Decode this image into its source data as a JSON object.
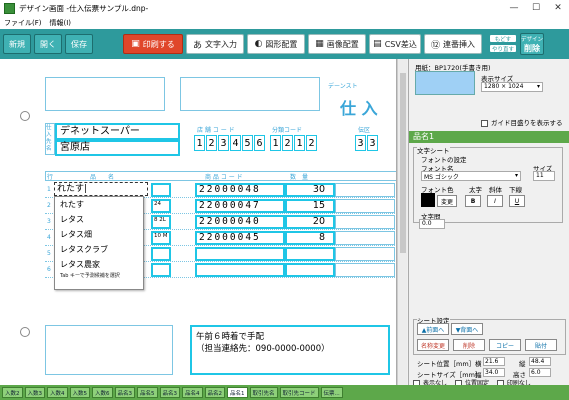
{
  "window": {
    "title": "デザイン画面 -仕入伝票サンプル.dnp-",
    "min": "—",
    "max": "☐",
    "close": "✕"
  },
  "menu": [
    "ファイル(F)",
    "情報(I)"
  ],
  "toolbar": {
    "new": "新規",
    "open": "開く",
    "save": "保存",
    "print": "印刷する",
    "text_input": "文字入力",
    "shape": "図形配置",
    "image": "画像配置",
    "csv": "CSV差込",
    "serial": "連番挿入",
    "undo": "もどす",
    "redo": "やり直す",
    "del_top": "デザイン",
    "del": "削除"
  },
  "doc": {
    "title_label": "デーンスト",
    "title_big": "仕 入",
    "vendor_side": "仕入先名",
    "company": "デネットスーパー",
    "branch": "宮原店",
    "shop_code_label": "店 舗 コ ー ド",
    "shop_code": [
      "1",
      "2",
      "3",
      "4",
      "5",
      "6"
    ],
    "cat_code_label": "分類コード",
    "cat_code": [
      "1",
      "2",
      "1",
      "2"
    ],
    "col3_label": "伝区",
    "col3": [
      "3",
      "3"
    ],
    "row_label": "行",
    "name_label": "品　　名",
    "code_label": "商 品 コ ー ド",
    "qty_label": "数　量",
    "rows": [
      {
        "n": "1",
        "input": "れたす",
        "num": "",
        "code": "22000048",
        "qty": "30"
      },
      {
        "n": "2",
        "input": "",
        "num": "24",
        "code": "22000047",
        "qty": "15"
      },
      {
        "n": "3",
        "input": "",
        "num": "8 2L",
        "code": "22000040",
        "qty": "20"
      },
      {
        "n": "4",
        "input": "",
        "num": "10 M",
        "code": "22000045",
        "qty": "8"
      },
      {
        "n": "5",
        "input": "",
        "num": "",
        "code": "",
        "qty": ""
      },
      {
        "n": "6",
        "input": "",
        "num": "",
        "code": "",
        "qty": ""
      }
    ],
    "memo_line1": "午前６時着で手配",
    "memo_line2": "（担当連絡先：090-0000-0000）"
  },
  "autocomplete": {
    "items": [
      "れたす",
      "レタス",
      "レタス畑",
      "レタスクラブ",
      "レタス農家"
    ],
    "hint": "Tab キーで予測候補を選択"
  },
  "panel": {
    "paper": "用紙：BP1720(手書き用)",
    "display_size_label": "表示サイズ",
    "display_size": "1280 × 1024",
    "guide": "ガイド目盛りを表示する",
    "section_title": "品名1",
    "text_sheet": "文字シート",
    "font_settings": "フォントの設定",
    "font_name_label": "フォント名",
    "font_name": "MS ゴシック",
    "size_label": "サイズ",
    "size": "11",
    "font_color": "フォント色",
    "bold_label": "太字",
    "italic_label": "斜体",
    "underline_label": "下線",
    "change": "変更",
    "bold": "B",
    "italic": "I",
    "underline": "U",
    "spacing_label": "文字間",
    "spacing": "0.0",
    "sheet_settings": "シート設定",
    "front": "▲前面へ",
    "back": "▼背面へ",
    "rename": "名称変更",
    "delete": "削除",
    "copy": "コピー",
    "paste": "貼付",
    "pos_label": "シート位置［mm］",
    "x_label": "横",
    "x": "21.6",
    "y_label": "縦",
    "y": "48.4",
    "sz_label": "シートサイズ［mm］",
    "w_label": "幅",
    "w": "34.0",
    "h_label": "高さ",
    "h": "6.0",
    "hide": "表示なし",
    "lock": "位置固定",
    "noprint": "印刷なし"
  },
  "tabs": [
    "入数2",
    "入数3",
    "入数4",
    "入数5",
    "入数6",
    "品名3",
    "品名5",
    "品名3",
    "品名4",
    "品名2",
    "品名1",
    "取引先名",
    "取引先コード",
    "伝票..."
  ]
}
